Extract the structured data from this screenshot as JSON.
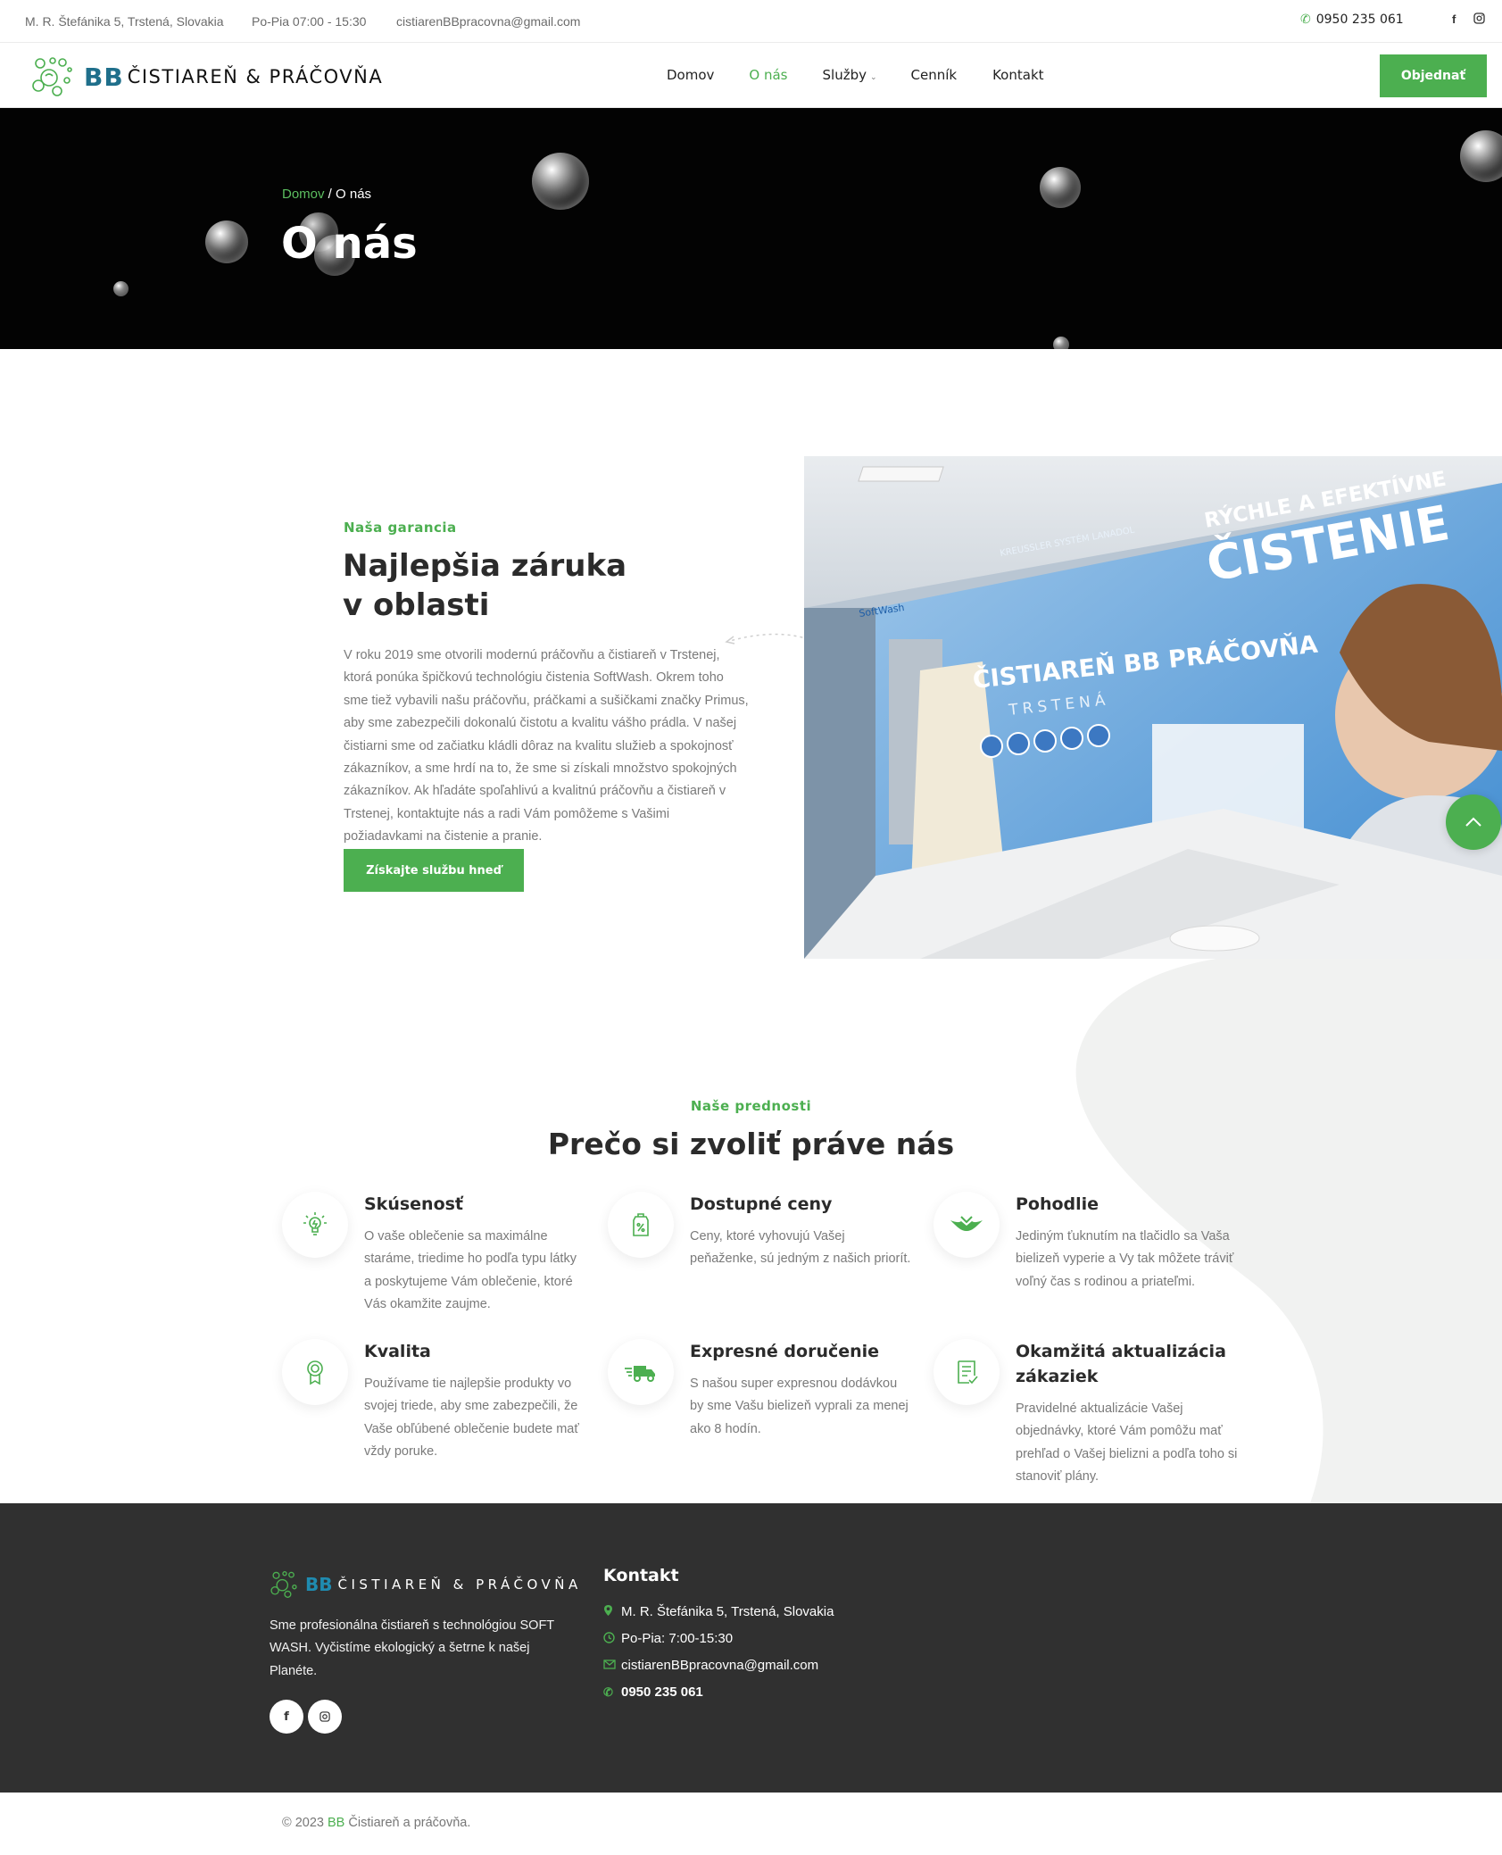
{
  "topbar": {
    "address": "M. R. Štefánika 5, Trstená, Slovakia",
    "hours": "Po-Pia 07:00 - 15:30",
    "email": "cistiarenBBpracovna@gmail.com",
    "phone": "0950 235 061"
  },
  "brand": {
    "bb": "BB",
    "name": "ČISTIAREŇ & PRÁČOVŇA"
  },
  "nav": {
    "items": [
      {
        "label": "Domov"
      },
      {
        "label": "O nás"
      },
      {
        "label": "Služby"
      },
      {
        "label": "Cenník"
      },
      {
        "label": "Kontakt"
      }
    ],
    "order_label": "Objednať"
  },
  "hero": {
    "breadcrumb_home": "Domov",
    "breadcrumb_sep": " / ",
    "breadcrumb_current": "O nás",
    "title": "O nás"
  },
  "about": {
    "kicker": "Naša garancia",
    "title_line1": "Najlepšia záruka",
    "title_line2": "v oblasti",
    "text": "V roku 2019 sme otvorili modernú práčovňu a čistiareň v Trstenej, ktorá ponúka špičkovú technológiu čistenia SoftWash. Okrem toho sme tiež vybavili našu práčovňu, práčkami a sušičkami značky Primus, aby sme zabezpečili dokonalú čistotu a kvalitu vášho prádla. V našej čistiarni sme od začiatku kládli dôraz na kvalitu služieb a spokojnosť zákazníkov, a sme hrdí na to, že sme si získali množstvo spokojných zákazníkov. Ak hľadáte spoľahlivú a kvalitnú práčovňu a čistiareň v Trstenej, kontaktujte nás a radi Vám pomôžeme s Vašimi požiadavkami na čistenie a pranie.",
    "button": "Získajte službu hneď",
    "photo": {
      "banner_line1": "RÝCHLE A EFEKTÍVNE",
      "banner_line2": "ČISTENIE",
      "banner_brand": "ČISTIAREŇ BB PRÁČOVŇA",
      "banner_city": "TRSTENÁ",
      "banner_small": "KREUSSLER SYSTÉM LANADOL",
      "softwash": "SoftWash"
    }
  },
  "features": {
    "kicker": "Naše prednosti",
    "title": "Prečo si zvoliť práve nás",
    "items": [
      {
        "title": "Skúsenosť",
        "text": "O vaše oblečenie sa maximálne staráme, triedime ho podľa typu látky a poskytujeme Vám oblečenie, ktoré Vás okamžite zaujme.",
        "icon": "lightbulb-icon"
      },
      {
        "title": "Dostupné ceny",
        "text": "Ceny, ktoré vyhovujú Vašej peňaženke, sú jedným z našich priorít.",
        "icon": "price-tag-icon"
      },
      {
        "title": "Pohodlie",
        "text": "Jediným ťuknutím na tlačidlo sa Vaša bielizeň vyperie a Vy tak môžete tráviť voľný čas s rodinou a priateľmi.",
        "icon": "comfort-icon"
      },
      {
        "title": "Kvalita",
        "text": "Používame tie najlepšie produkty vo svojej triede, aby sme zabezpečili, že Vaše obľúbené oblečenie budete mať vždy poruke.",
        "icon": "award-icon"
      },
      {
        "title": "Expresné doručenie",
        "text": "S našou super expresnou dodávkou by sme Vašu bielizeň vyprali za menej ako 8 hodín.",
        "icon": "delivery-truck-icon"
      },
      {
        "title": "Okamžitá aktualizácia zákaziek",
        "text": "Pravidelné aktualizácie Vašej objednávky, ktoré Vám pomôžu mať prehľad o Vašej bielizni a podľa toho si stanoviť plány.",
        "icon": "checklist-icon"
      }
    ]
  },
  "footer": {
    "description": "Sme profesionálna čistiareň s technológiou SOFT WASH. Vyčistíme ekologický a šetrne k našej Planéte.",
    "contact_title": "Kontakt",
    "address": "M. R. Štefánika 5, Trstená, Slovakia",
    "hours": "Po-Pia: 7:00-15:30",
    "email": "cistiarenBBpracovna@gmail.com",
    "phone": "0950 235 061"
  },
  "copyright": {
    "prefix": "© 2023 ",
    "bb": "BB",
    "suffix": " Čistiareň a práčovňa."
  },
  "colors": {
    "accent": "#4caf50",
    "brand_blue": "#1f6f8b",
    "footer_bg": "#303030",
    "hero_bg": "#030303"
  }
}
